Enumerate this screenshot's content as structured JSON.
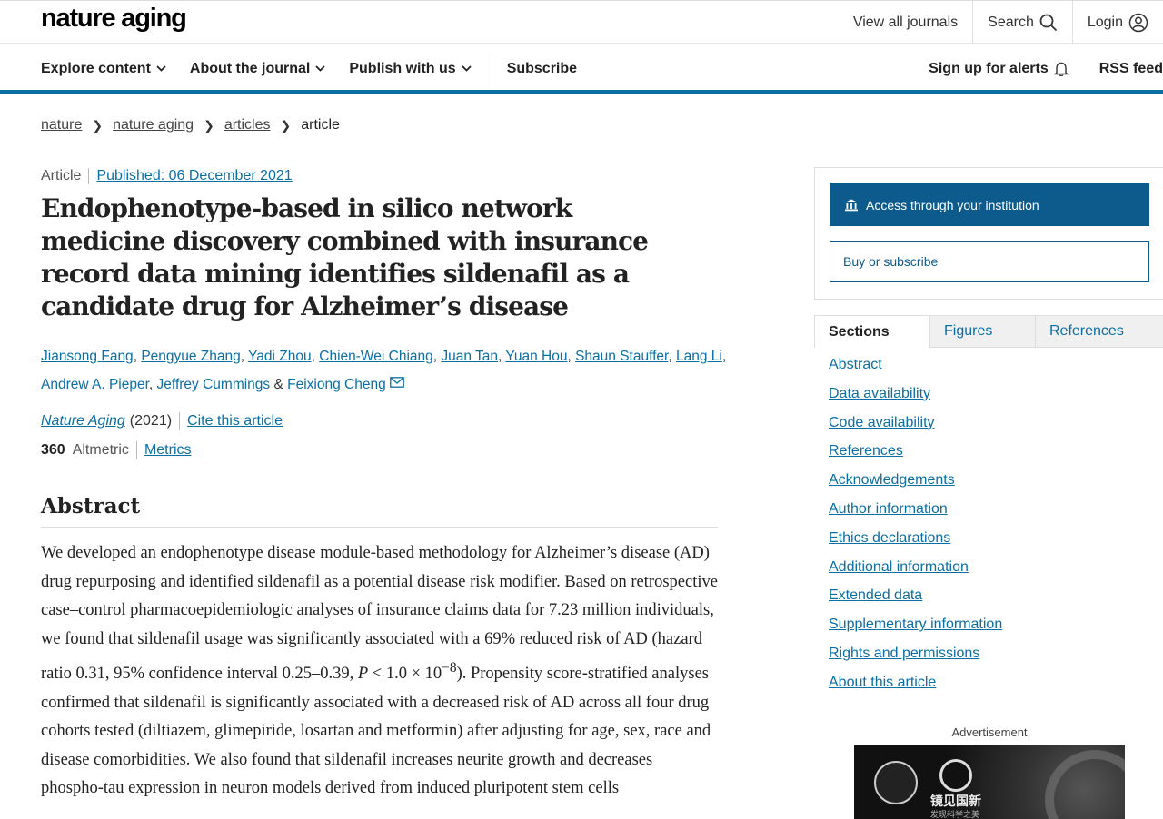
{
  "header": {
    "logo": "nature aging",
    "view_all_journals": "View all journals",
    "search": "Search",
    "login": "Login"
  },
  "nav": {
    "items": [
      "Explore content",
      "About the journal",
      "Publish with us"
    ],
    "subscribe": "Subscribe",
    "alerts": "Sign up for alerts",
    "rss": "RSS feed"
  },
  "breadcrumb": [
    "nature",
    "nature aging",
    "articles",
    "article"
  ],
  "article": {
    "type": "Article",
    "published": "Published: 06 December 2021",
    "title": "Endophenotype-based in silico network medicine discovery combined with insurance record data mining identifies sildenafil as a candidate drug for Alzheimer’s disease",
    "authors": [
      "Jiansong Fang",
      "Pengyue Zhang",
      "Yadi Zhou",
      "Chien-Wei Chiang",
      "Juan Tan",
      "Yuan Hou",
      "Shaun Stauffer",
      "Lang Li",
      "Andrew A. Pieper",
      "Jeffrey Cummings",
      "Feixiong Cheng"
    ],
    "journal": "Nature Aging",
    "year": "(2021)",
    "cite": "Cite this article",
    "altmetric_count": "360",
    "altmetric_label": "Altmetric",
    "metrics": "Metrics"
  },
  "abstract": {
    "heading": "Abstract",
    "text_1": "We developed an endophenotype disease module-based methodology for Alzheimer’s disease (AD) drug repurposing and identified sildenafil as a potential disease risk modifier. Based on retrospective case–control pharmacoepidemiologic analyses of insurance claims data for 7.23 million individuals, we found that sildenafil usage was significantly associated with a 69% reduced risk of AD (hazard ratio 0.31, 95% confidence interval 0.25–0.39, ",
    "p_symbol": "P",
    "text_2": " < 1.0 × 10",
    "exponent": "−8",
    "text_3": "). Propensity score-stratified analyses confirmed that sildenafil is significantly associated with a decreased risk of AD across all four drug cohorts tested (diltiazem, glimepiride, losartan and metformin) after adjusting for age, sex, race and disease comorbidities. We also found that sildenafil increases neurite growth and decreases phospho-tau expression in neuron models derived from induced pluripotent stem cells"
  },
  "sidebar": {
    "access_button": "Access through your institution",
    "buy_button": "Buy or subscribe",
    "tabs": [
      "Sections",
      "Figures",
      "References"
    ],
    "sections": [
      "Abstract",
      "Data availability",
      "Code availability",
      "References",
      "Acknowledgements",
      "Author information",
      "Ethics declarations",
      "Additional information",
      "Extended data",
      "Supplementary information",
      "Rights and permissions",
      "About this article"
    ],
    "ad_label": "Advertisement",
    "ad_text": "镜见国新",
    "ad_sub": "发现科学之美"
  },
  "colors": {
    "link": "#0b6fa4",
    "access_button": "#0d5b8c",
    "nav_underline": "#0b6fa4"
  }
}
